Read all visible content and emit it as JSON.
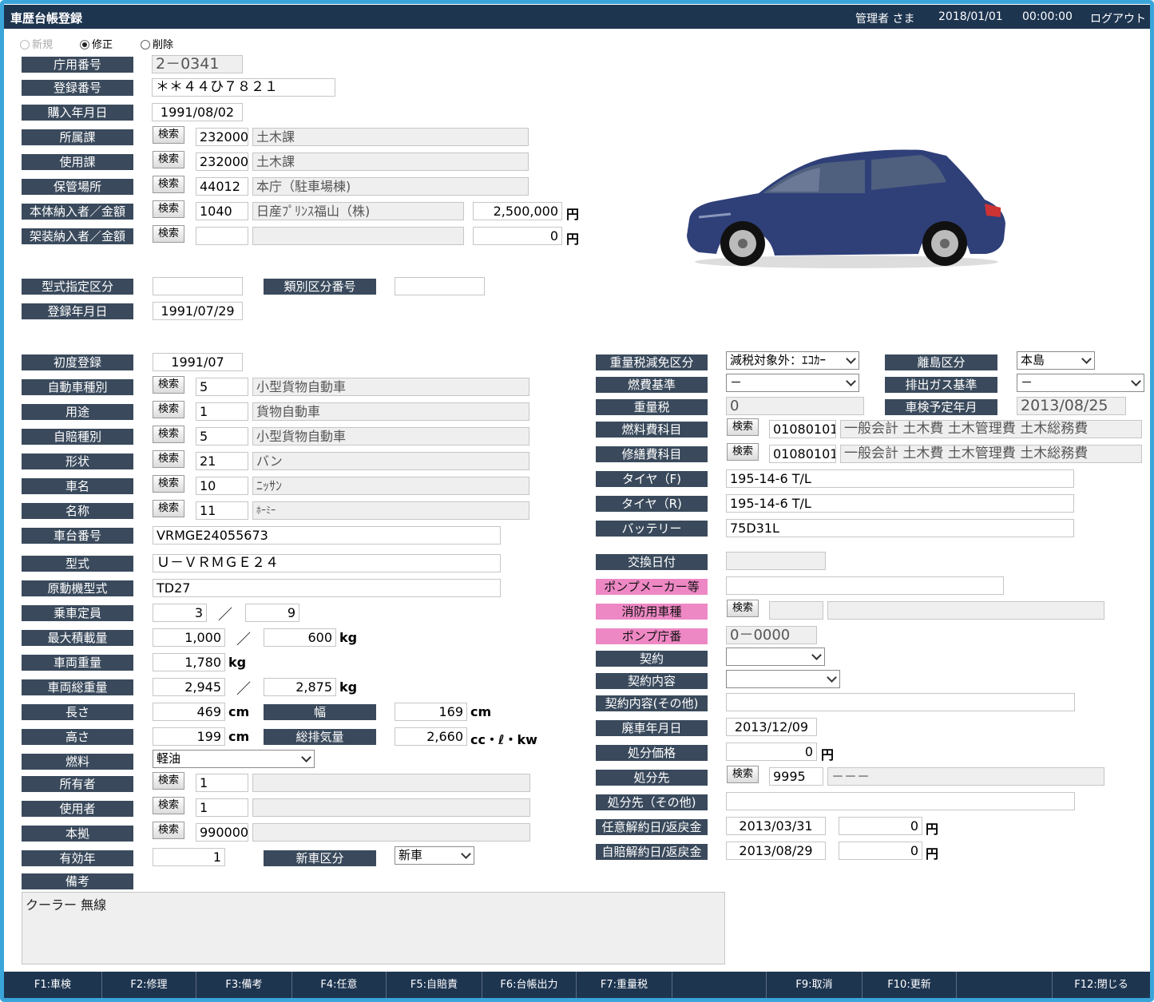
{
  "header": {
    "title": "車歴台帳登録",
    "user": "管理者 さま",
    "date": "2018/01/01",
    "time": "00:00:00",
    "logout": "ログアウト"
  },
  "mode": {
    "new": "新規",
    "edit": "修正",
    "delete": "削除"
  },
  "search": "検索",
  "yen": "円",
  "units": {
    "kg": "kg",
    "cm": "cm",
    "cc": "cc・ℓ・kw",
    "slash": "／"
  },
  "fields": {
    "agency_no": {
      "label": "庁用番号",
      "value": "2－0341"
    },
    "reg_no": {
      "label": "登録番号",
      "value": "＊＊４４ひ７８２１"
    },
    "purchase_date": {
      "label": "購入年月日",
      "value": "1991/08/02"
    },
    "dept": {
      "label": "所属課",
      "code": "232000",
      "name": "土木課"
    },
    "use_dept": {
      "label": "使用課",
      "code": "232000",
      "name": "土木課"
    },
    "storage": {
      "label": "保管場所",
      "code": "44012",
      "name": "本庁（駐車場棟)"
    },
    "body_supplier": {
      "label": "本体納入者／金額",
      "code": "1040",
      "name": "日産ﾌﾟﾘﾝｽ福山（株)",
      "amount": "2,500,000"
    },
    "equip_supplier": {
      "label": "架装納入者／金額",
      "code": "",
      "name": "",
      "amount": "0"
    },
    "type_designation": {
      "label": "型式指定区分",
      "value": ""
    },
    "category_no": {
      "label": "類別区分番号",
      "value": ""
    },
    "reg_date": {
      "label": "登録年月日",
      "value": "1991/07/29"
    },
    "first_reg": {
      "label": "初度登録",
      "value": "1991/07"
    },
    "vehicle_type": {
      "label": "自動車種別",
      "code": "5",
      "name": "小型貨物自動車"
    },
    "purpose": {
      "label": "用途",
      "code": "1",
      "name": "貨物自動車"
    },
    "insurance_type": {
      "label": "自賠種別",
      "code": "5",
      "name": "小型貨物自動車"
    },
    "shape": {
      "label": "形状",
      "code": "21",
      "name": "バン"
    },
    "car_name": {
      "label": "車名",
      "code": "10",
      "name": "ﾆｯｻﾝ"
    },
    "model_name": {
      "label": "名称",
      "code": "11",
      "name": "ﾎｰﾐｰ"
    },
    "chassis_no": {
      "label": "車台番号",
      "value": "VRMGE24055673"
    },
    "model": {
      "label": "型式",
      "value": "Ｕ－ＶＲＭＧＥ２４"
    },
    "engine": {
      "label": "原動機型式",
      "value": "TD27"
    },
    "capacity": {
      "label": "乗車定員",
      "a": "3",
      "b": "9"
    },
    "max_load": {
      "label": "最大積載量",
      "a": "1,000",
      "b": "600"
    },
    "weight": {
      "label": "車両重量",
      "value": "1,780"
    },
    "gross_weight": {
      "label": "車両総重量",
      "a": "2,945",
      "b": "2,875"
    },
    "length": {
      "label": "長さ",
      "value": "469"
    },
    "width": {
      "label": "幅",
      "value": "169"
    },
    "height": {
      "label": "高さ",
      "value": "199"
    },
    "displacement": {
      "label": "総排気量",
      "value": "2,660"
    },
    "fuel": {
      "label": "燃料",
      "value": "軽油"
    },
    "owner": {
      "label": "所有者",
      "code": "1",
      "name": ""
    },
    "user": {
      "label": "使用者",
      "code": "1",
      "name": ""
    },
    "base": {
      "label": "本拠",
      "code": "990000",
      "name": ""
    },
    "valid_years": {
      "label": "有効年",
      "value": "1"
    },
    "new_flag": {
      "label": "新車区分",
      "value": "新車"
    },
    "remarks": {
      "label": "備考",
      "value": "クーラー 無線"
    },
    "tax_reduction": {
      "label": "重量税減免区分",
      "value": "減税対象外：ｴｺｶｰ"
    },
    "island": {
      "label": "離島区分",
      "value": "本島"
    },
    "fuel_std": {
      "label": "燃費基準",
      "value": "－"
    },
    "emission_std": {
      "label": "排出ガス基準",
      "value": "－"
    },
    "weight_tax": {
      "label": "重量税",
      "value": "0"
    },
    "inspection_date": {
      "label": "車検予定年月",
      "value": "2013/08/25"
    },
    "fuel_account": {
      "label": "燃料費科目",
      "code": "01080101",
      "name": "一般会計 土木費 土木管理費 土木総務費"
    },
    "repair_account": {
      "label": "修繕費科目",
      "code": "01080101",
      "name": "一般会計 土木費 土木管理費 土木総務費"
    },
    "tire_f": {
      "label": "タイヤ（F)",
      "value": "195-14-6 T/L"
    },
    "tire_r": {
      "label": "タイヤ（R)",
      "value": "195-14-6 T/L"
    },
    "battery": {
      "label": "バッテリー",
      "value": "75D31L"
    },
    "exchange_date": {
      "label": "交換日付",
      "value": ""
    },
    "pump_maker": {
      "label": "ポンプメーカー等",
      "value": ""
    },
    "fire_type": {
      "label": "消防用車種",
      "code": "",
      "name": ""
    },
    "pump_no": {
      "label": "ポンプ庁番",
      "value": "0－0000"
    },
    "contract": {
      "label": "契約",
      "value": ""
    },
    "contract_detail": {
      "label": "契約内容",
      "value": ""
    },
    "contract_other": {
      "label": "契約内容(その他)",
      "value": ""
    },
    "scrap_date": {
      "label": "廃車年月日",
      "value": "2013/12/09"
    },
    "disposal_price": {
      "label": "処分価格",
      "value": "0"
    },
    "disposal_to": {
      "label": "処分先",
      "code": "9995",
      "name": "－－－"
    },
    "disposal_other": {
      "label": "処分先（その他)",
      "value": ""
    },
    "voluntary_cancel": {
      "label": "任意解約日/返戻金",
      "date": "2013/03/31",
      "amount": "0"
    },
    "insurance_cancel": {
      "label": "自賠解約日/返戻金",
      "date": "2013/08/29",
      "amount": "0"
    }
  },
  "fkeys": [
    "F1:車検",
    "F2:修理",
    "F3:備考",
    "F4:任意",
    "F5:自賠責",
    "F6:台帳出力",
    "F7:重量税",
    "",
    "F9:取消",
    "F10:更新",
    "",
    "F12:閉じる"
  ],
  "colors": {
    "header": "#1e3550",
    "label": "#3a4a5c",
    "pink": "#ee88c4",
    "frame": "#3aa5d9",
    "car": "#2f3f78"
  }
}
